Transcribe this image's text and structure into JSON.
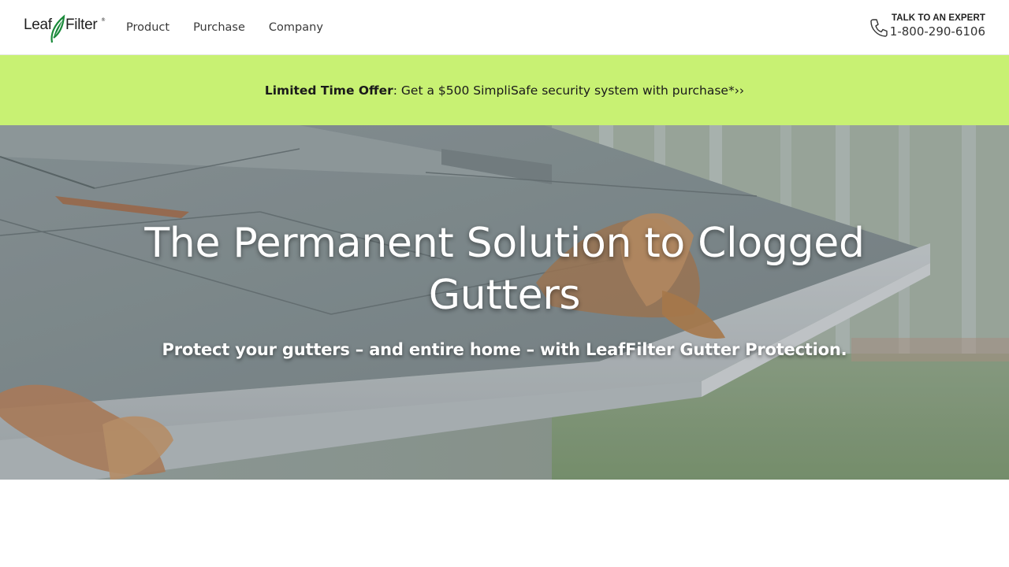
{
  "brand": {
    "logo_left": "Leaf",
    "logo_right": "Filter",
    "logo_mark": "®",
    "leaf_icon": "leaf-icon",
    "accent_color": "#1a8a3a"
  },
  "nav": {
    "items": [
      {
        "label": "Product"
      },
      {
        "label": "Purchase"
      },
      {
        "label": "Company"
      }
    ]
  },
  "contact": {
    "label": "TALK TO AN EXPERT",
    "phone": "1-800-290-6106",
    "icon": "phone-icon"
  },
  "promo": {
    "bold_text": "Limited Time Offer",
    "text": ": Get a $500 SimpliSafe security system with purchase*",
    "arrow": "››",
    "background": "#c8f173"
  },
  "hero": {
    "title": "The Permanent Solution to Clogged Gutters",
    "subtitle": "Protect your gutters – and entire home – with LeafFilter Gutter Protection."
  }
}
